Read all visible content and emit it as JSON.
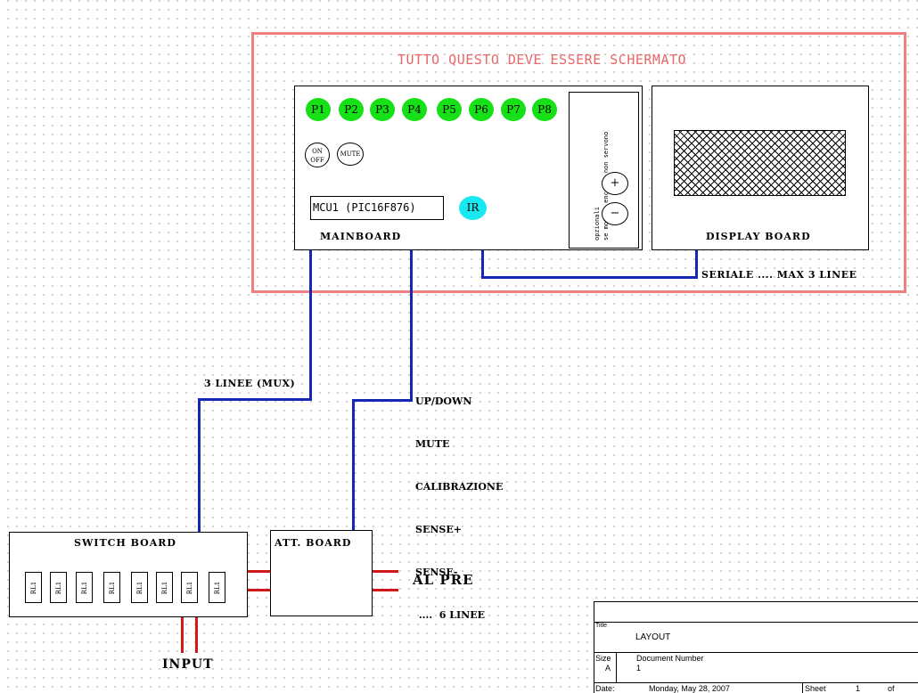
{
  "shield": {
    "title": "TUTTO QUESTO DEVE ESSERE SCHERMATO",
    "color": "#f08080"
  },
  "mainboard": {
    "label": "MAINBOARD",
    "buttons": [
      "P1",
      "P2",
      "P3",
      "P4",
      "P5",
      "P6",
      "P7",
      "P8"
    ],
    "on_off": [
      "ON",
      "OFF"
    ],
    "mute": "MUTE",
    "mcu": "MCU1 (PIC16F876)",
    "ir": "IR",
    "optional_text": [
      "opzionali",
      "se mot. o encoder non servono"
    ],
    "plus": "+",
    "minus": "−"
  },
  "display_board": {
    "label": "DISPLAY BOARD"
  },
  "links": {
    "serial": "SERIALE .... MAX 3 LINEE",
    "mux": "3 LINEE (MUX)",
    "att_lines": [
      "UP/DOWN",
      "MUTE",
      "CALIBRAZIONE",
      "SENSE+",
      "SENSE-",
      " ....  6 LINEE"
    ]
  },
  "switch_board": {
    "label": "SWITCH BOARD",
    "relays": [
      "RL1",
      "RL1",
      "RL1",
      "RL1",
      "RL1",
      "RL1",
      "RL1",
      "RL1"
    ]
  },
  "att_board": {
    "label": "ATT. BOARD"
  },
  "io": {
    "output": "AL PRE",
    "input": "INPUT"
  },
  "title_block": {
    "title_hdr": "Title",
    "title": "LAYOUT",
    "size_hdr": "Size",
    "size": "A",
    "docnum_hdr": "Document Number",
    "docnum": "1",
    "date_hdr": "Date:",
    "date": "Monday, May 28, 2007",
    "sheet_hdr": "Sheet",
    "sheet": "1",
    "of": "of"
  },
  "colors": {
    "wire": "#1428b4",
    "power": "#d01818",
    "button": "#16e016",
    "ir": "#18e8f0"
  }
}
